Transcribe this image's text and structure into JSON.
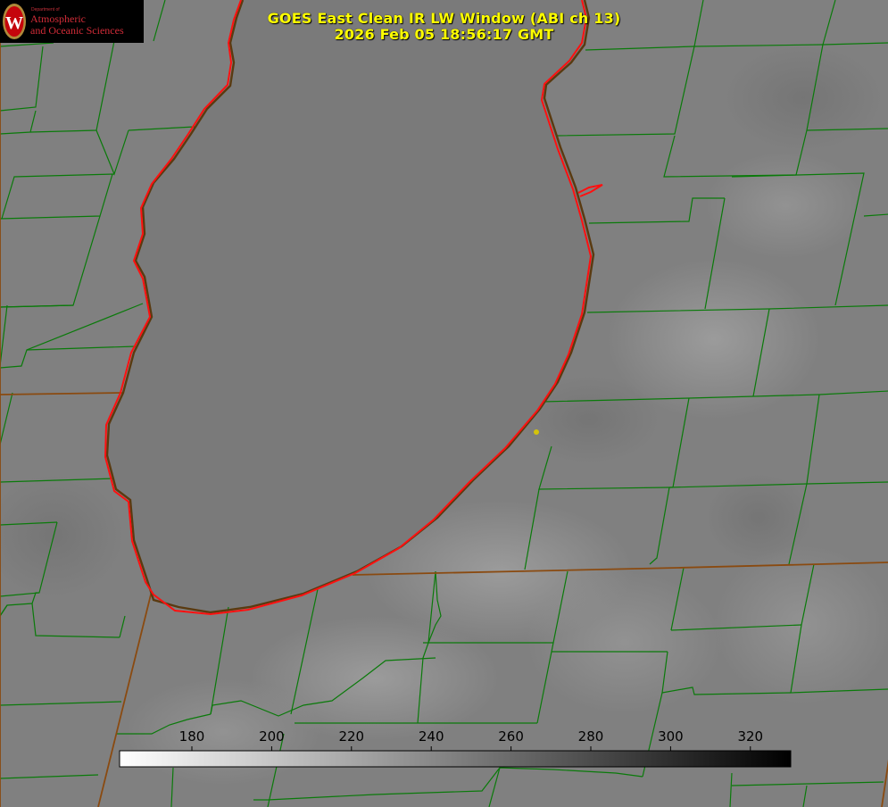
{
  "title": {
    "line1": "GOES East Clean IR LW Window (ABI ch 13)",
    "line2": "2026 Feb 05 18:56:17 GMT"
  },
  "logo": {
    "department": "Department of",
    "name_line1": "Atmospheric",
    "name_line2": "and Oceanic Sciences",
    "seal_letter": "W"
  },
  "colorbar": {
    "ticks": [
      "180",
      "200",
      "220",
      "240",
      "260",
      "280",
      "300",
      "320"
    ],
    "min_color": "#ffffff",
    "max_color": "#000000"
  },
  "colors": {
    "background": "#808080",
    "lake": "#7a7a7a",
    "shoreline_red": "#ff1010",
    "shoreline_dark": "#5a3a10",
    "county_lines": "#0a7a0a",
    "state_lines": "#8a4a10",
    "title_text": "#ffff00",
    "site_marker": "#d4c40a"
  }
}
